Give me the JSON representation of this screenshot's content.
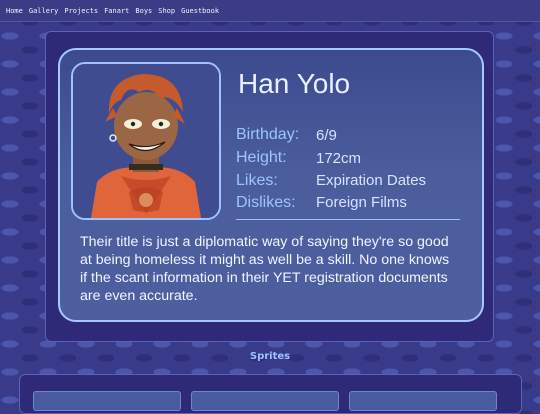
{
  "nav": {
    "items": [
      "Home",
      "Gallery",
      "Projects",
      "Fanart",
      "Boys",
      "Shop",
      "Guestbook"
    ]
  },
  "profile": {
    "name": "Han Yolo",
    "stats": [
      {
        "label": "Birthday:",
        "value": "6/9"
      },
      {
        "label": "Height:",
        "value": "172cm"
      },
      {
        "label": "Likes:",
        "value": "Expiration Dates"
      },
      {
        "label": "Dislikes:",
        "value": "Foreign Films"
      }
    ],
    "bio": "Their title is just a diplomatic way of saying they're so good at being homeless it might as well be a skill. No one knows if the scant information in their YET registration documents are even accurate."
  },
  "sprites": {
    "heading": "Sprites"
  },
  "colors": {
    "accent": "#9ec4ff",
    "background": "#3a3a8a"
  }
}
